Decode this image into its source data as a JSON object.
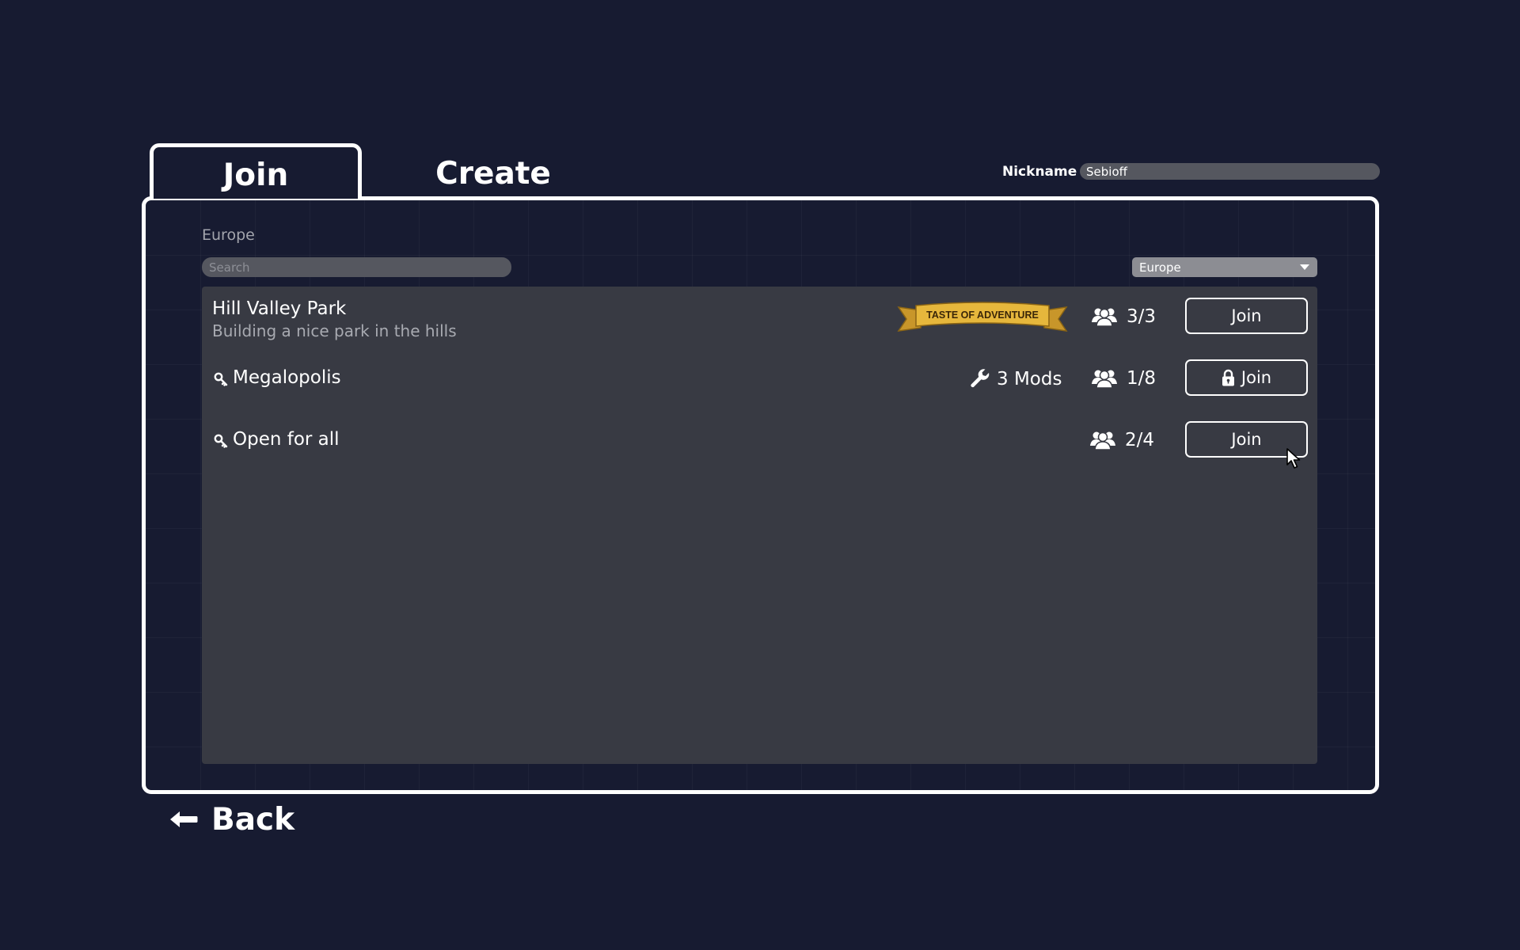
{
  "tabs": {
    "join_label": "Join",
    "create_label": "Create",
    "active": "Join"
  },
  "nickname": {
    "label": "Nickname",
    "value": "Sebioff"
  },
  "region": {
    "label": "Europe",
    "selected": "Europe"
  },
  "search": {
    "placeholder": "Search"
  },
  "servers": [
    {
      "name": "Hill Valley Park",
      "description": "Building a nice park in the hills",
      "badge": "TASTE OF ADVENTURE",
      "players": "3/3",
      "join_label": "Join",
      "locked": false
    },
    {
      "name": "Megalopolis",
      "mods": "3 Mods",
      "players": "1/8",
      "join_label": "Join",
      "locked": true
    },
    {
      "name": "Open for all",
      "players": "2/4",
      "join_label": "Join",
      "locked": false
    }
  ],
  "back": {
    "label": "Back"
  },
  "icons": {
    "players": "people-icon",
    "mods": "wrench-icon",
    "locked_join": "lock-icon",
    "server_key": "key-icon",
    "back": "arrow-left-icon"
  },
  "colors": {
    "background": "#171b31",
    "list_background": "#383a43",
    "banner_gold": "#e6b73c",
    "banner_text": "#3a2608",
    "input_background": "#55575f"
  }
}
